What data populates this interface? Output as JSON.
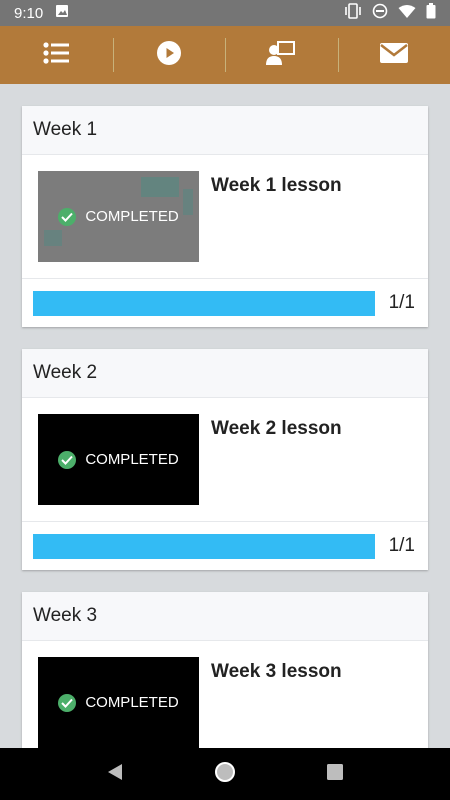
{
  "status_bar": {
    "time": "9:10"
  },
  "toolbar": {
    "items": [
      {
        "icon": "list-icon"
      },
      {
        "icon": "play-icon"
      },
      {
        "icon": "teacher-icon"
      },
      {
        "icon": "mail-icon"
      }
    ]
  },
  "weeks": [
    {
      "header": "Week 1",
      "lesson": "Week 1 lesson",
      "status": "COMPLETED",
      "progress_text": "1/1",
      "progress": 1.0,
      "thumb": "grey"
    },
    {
      "header": "Week 2",
      "lesson": "Week 2 lesson",
      "status": "COMPLETED",
      "progress_text": "1/1",
      "progress": 1.0,
      "thumb": "black"
    },
    {
      "header": "Week 3",
      "lesson": "Week 3 lesson",
      "status": "COMPLETED",
      "thumb": "black"
    }
  ],
  "colors": {
    "toolbar": "#b27a3a",
    "progress": "#33bbf4",
    "check": "#4caf6a"
  }
}
